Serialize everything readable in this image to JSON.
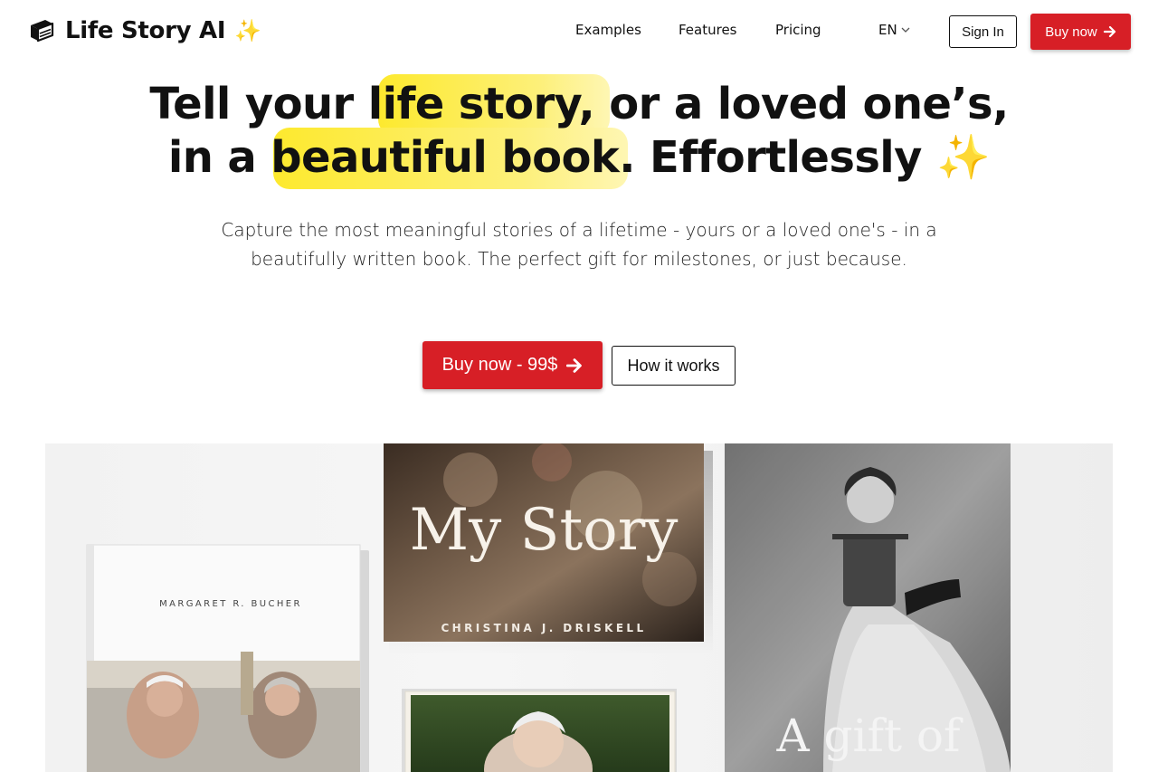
{
  "brand": {
    "name": "Life Story AI",
    "sparkle": "✨",
    "icon": "book-icon"
  },
  "nav": {
    "links": [
      {
        "label": "Examples"
      },
      {
        "label": "Features"
      },
      {
        "label": "Pricing"
      }
    ],
    "language": "EN",
    "sign_in": "Sign In",
    "buy_now": "Buy now"
  },
  "hero": {
    "title_line1_a": "Tell your",
    "title_line1_highlight": "life story,",
    "title_line1_b": "or a loved one’s,",
    "title_line2_a": "in a",
    "title_line2_highlight": "beautiful book.",
    "title_line2_b": "Effortlessly",
    "title_sparkle": "✨",
    "subtitle": "Capture the most meaningful stories of a lifetime - yours or a loved one's - in a beautifully written book. The perfect gift for milestones, or just because.",
    "cta_primary": "Buy now - 99$",
    "cta_secondary": "How it works"
  },
  "books": {
    "book1_author": "MARGARET R. BUCHER",
    "book2_title": "My Story",
    "book2_author": "CHRISTINA J. DRISKELL",
    "book3_title": "A gift of"
  },
  "colors": {
    "accent": "#d71f26",
    "highlight": "#fde92e"
  }
}
